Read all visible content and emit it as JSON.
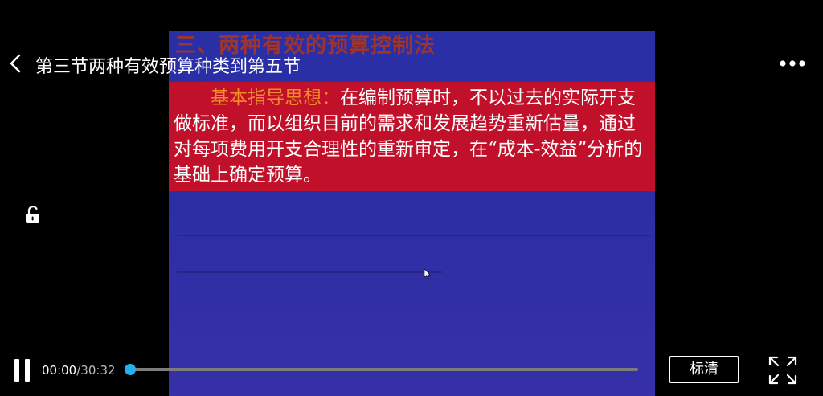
{
  "header": {
    "title": "第三节两种有效预算种类到第五节",
    "back_icon": "chevron-left-icon",
    "more_icon": "more-dots-icon"
  },
  "slide": {
    "title": "三、两种有效的预算控制法",
    "lead_label": "基本指导思想：",
    "body": "在编制预算时，不以过去的实际开支做标准，而以组织目前的需求和发展趋势重新估量，通过对每项费用开支合理性的重新审定，在“成本-效益”分析的基础上确定预算。",
    "colors": {
      "background": "#2c2ea4",
      "box": "#c0102a",
      "lead": "#f08a2a",
      "title": "#b0361c"
    }
  },
  "controls": {
    "current_time": "00:00",
    "separator": "/",
    "duration": "30:32",
    "progress": 0,
    "quality_label": "标清",
    "pause_icon": "pause-icon",
    "lock_icon": "unlock-icon",
    "fullscreen_icon": "fullscreen-icon",
    "accent_color": "#1fb3ea"
  }
}
